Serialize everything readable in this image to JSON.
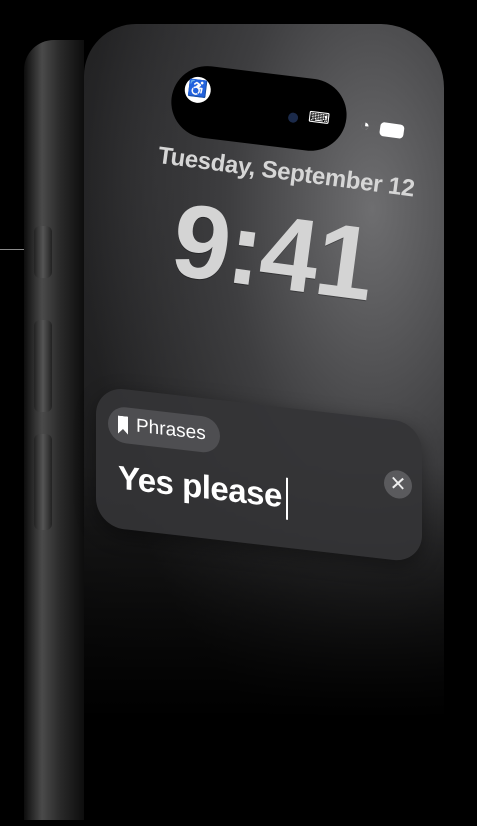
{
  "lockscreen": {
    "date": "Tuesday, September 12",
    "time": "9:41"
  },
  "island": {
    "accessibility_icon": "accessibility-icon",
    "accessibility_glyph": "♿",
    "keyboard_icon": "keyboard-icon",
    "keyboard_glyph": "⌨"
  },
  "status_bar": {
    "wifi_icon": "wifi-icon",
    "wifi_glyph": "◔",
    "battery_icon": "battery-icon"
  },
  "phrases_card": {
    "chip_icon": "bookmark-icon",
    "chip_label": "Phrases",
    "text": "Yes please",
    "close_icon": "close-icon",
    "close_glyph": "✕"
  }
}
